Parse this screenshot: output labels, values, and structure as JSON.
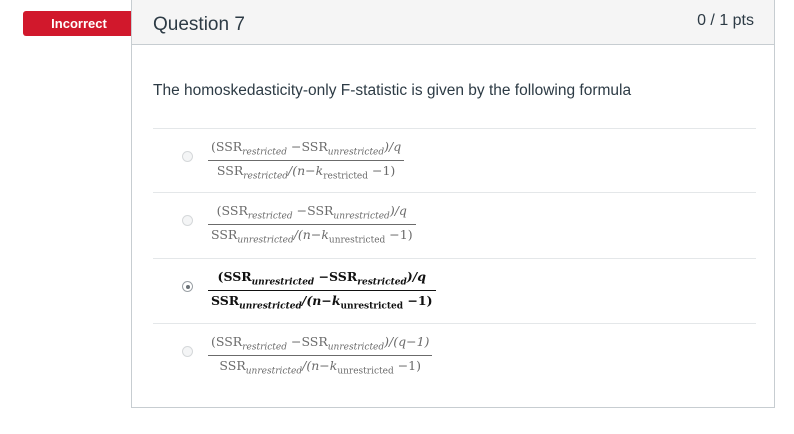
{
  "status": {
    "label": "Incorrect"
  },
  "question": {
    "title": "Question 7",
    "points": "0 / 1 pts",
    "text": "The homoskedasticity-only F-statistic is given by the following formula"
  },
  "answers": [
    {
      "selected": false,
      "num": {
        "ssr1": "(SSR",
        "sub1": "restricted",
        "minus": " −SSR",
        "sub2": "unrestricted",
        "tail": ")/q"
      },
      "den": {
        "ssr": "SSR",
        "sub": "restricted",
        "mid": "/(n−k",
        "ksub": "restricted",
        "tail": " −1)"
      }
    },
    {
      "selected": false,
      "num": {
        "ssr1": "(SSR",
        "sub1": "restricted",
        "minus": " −SSR",
        "sub2": "unrestricted",
        "tail": ")/q"
      },
      "den": {
        "ssr": "SSR",
        "sub": "unrestricted",
        "mid": "/(n−k",
        "ksub": "unrestricted",
        "tail": " −1)"
      }
    },
    {
      "selected": true,
      "num": {
        "ssr1": "(SSR",
        "sub1": "unrestricted",
        "minus": " −SSR",
        "sub2": "restricted",
        "tail": ")/q"
      },
      "den": {
        "ssr": "SSR",
        "sub": "unrestricted",
        "mid": "/(n−k",
        "ksub": "unrestricted",
        "tail": " −1)"
      }
    },
    {
      "selected": false,
      "num": {
        "ssr1": "(SSR",
        "sub1": "restricted",
        "minus": " −SSR",
        "sub2": "unrestricted",
        "tail": ")/(q−1)"
      },
      "den": {
        "ssr": "SSR",
        "sub": "unrestricted",
        "mid": "/(n−k",
        "ksub": "unrestricted",
        "tail": " −1)"
      }
    }
  ]
}
